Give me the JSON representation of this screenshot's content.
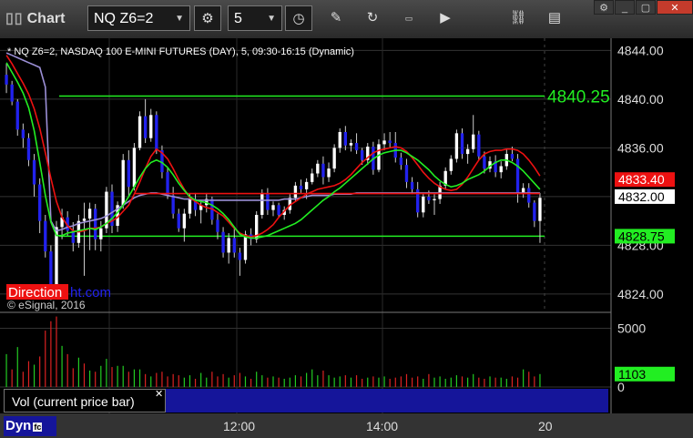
{
  "toolbar": {
    "app_title": "Chart",
    "symbol": "NQ Z6=2",
    "interval": "5",
    "icons": [
      "bars-icon",
      "chevron-down-icon",
      "gear-icon",
      "chevron-down-icon",
      "clock-icon",
      "pencil-icon",
      "refresh-icon",
      "get-icon",
      "play-icon",
      "link-icon",
      "comment-icon"
    ],
    "window_controls": [
      "settings-icon",
      "minimize-icon",
      "maximize-icon",
      "close-icon"
    ]
  },
  "chart_data": {
    "type": "candlestick",
    "title": "* NQ Z6=2, NASDAQ 100 E-MINI FUTURES (DAY), 5, 09:30-16:15 (Dynamic)",
    "watermark_left": "Direction",
    "watermark_right": "ht.com",
    "copyright": "© eSignal, 2016",
    "ylim": [
      4822.5,
      4845
    ],
    "yticks": [
      4824,
      4828,
      4832,
      4836,
      4840,
      4844
    ],
    "ytick_labels": [
      "4824.00",
      "4828.00",
      "4832.00",
      "4836.00",
      "4840.00",
      "4844.00"
    ],
    "xticks": [
      "12:00",
      "14:00",
      "20"
    ],
    "horizontal_lines": [
      {
        "value": 4840.25,
        "label": "4840.25",
        "color": "#22ee22"
      },
      {
        "value": 4828.75,
        "label": "4828.75",
        "color": "#22ee22"
      }
    ],
    "price_tags": [
      {
        "value": 4833.4,
        "label": "4833.40",
        "bg": "#ee1111",
        "fg": "#ffffff"
      },
      {
        "value": 4832.0,
        "label": "4832.00",
        "bg": "#ffffff",
        "fg": "#000000"
      },
      {
        "value": 4828.75,
        "label": "4828.75",
        "bg": "#22ee22",
        "fg": "#000000"
      }
    ],
    "candles": [
      [
        4842,
        4842.9,
        4840.5,
        4841.2
      ],
      [
        4841.2,
        4841.5,
        4839.5,
        4839.8
      ],
      [
        4839.8,
        4840,
        4837,
        4837.5
      ],
      [
        4837.5,
        4838,
        4836,
        4836.8
      ],
      [
        4836.8,
        4837.2,
        4834.5,
        4835
      ],
      [
        4835,
        4835.5,
        4832,
        4833
      ],
      [
        4833,
        4833.5,
        4829,
        4830
      ],
      [
        4830,
        4830.5,
        4827,
        4827.5
      ],
      [
        4827.5,
        4828,
        4823.5,
        4824.6
      ],
      [
        4824.6,
        4830,
        4824.3,
        4829.5
      ],
      [
        4829.5,
        4831,
        4828.5,
        4830.3
      ],
      [
        4830.3,
        4830.8,
        4828.8,
        4829.2
      ],
      [
        4829.2,
        4829.9,
        4827.5,
        4828.2
      ],
      [
        4828.2,
        4830.5,
        4827.8,
        4830
      ],
      [
        4830,
        4831.5,
        4825.5,
        4830.2
      ],
      [
        4830.2,
        4831.5,
        4827.6,
        4831
      ],
      [
        4831,
        4831.4,
        4827.6,
        4828.5
      ],
      [
        4828.5,
        4830,
        4827.5,
        4829.4
      ],
      [
        4829.4,
        4832.8,
        4829,
        4832.4
      ],
      [
        4832.4,
        4833,
        4829,
        4829.6
      ],
      [
        4829.6,
        4831.6,
        4829.1,
        4831.3
      ],
      [
        4831.3,
        4835.5,
        4831,
        4835
      ],
      [
        4835,
        4835.8,
        4832,
        4832.8
      ],
      [
        4832.8,
        4836.4,
        4832.5,
        4836
      ],
      [
        4836,
        4839,
        4835.8,
        4838.6
      ],
      [
        4838.6,
        4840,
        4836.4,
        4836.8
      ],
      [
        4836.8,
        4839.2,
        4836.5,
        4838.7
      ],
      [
        4838.7,
        4839,
        4835.5,
        4835.8
      ],
      [
        4835.8,
        4836.2,
        4833.5,
        4834
      ],
      [
        4834,
        4834.4,
        4831.8,
        4832.1
      ],
      [
        4832.1,
        4832.8,
        4830.2,
        4830.6
      ],
      [
        4830.6,
        4831,
        4829.1,
        4829.4
      ],
      [
        4829.4,
        4831,
        4828.3,
        4830.6
      ],
      [
        4830.6,
        4832.2,
        4830.2,
        4831.8
      ],
      [
        4831.8,
        4832.3,
        4830.4,
        4830.9
      ],
      [
        4830.9,
        4831.7,
        4829.8,
        4831.3
      ],
      [
        4831.3,
        4832.3,
        4830.7,
        4831.8
      ],
      [
        4831.8,
        4832,
        4829.7,
        4830.1
      ],
      [
        4830.1,
        4830.6,
        4828.5,
        4829.1
      ],
      [
        4829.1,
        4829.5,
        4827,
        4827.4
      ],
      [
        4827.4,
        4829,
        4826.5,
        4828.6
      ],
      [
        4828.6,
        4829.5,
        4827,
        4827.4
      ],
      [
        4827.4,
        4827.8,
        4825.5,
        4826.8
      ],
      [
        4826.8,
        4829.2,
        4826.5,
        4828.9
      ],
      [
        4828.9,
        4829.4,
        4828,
        4828.5
      ],
      [
        4828.5,
        4830.8,
        4828.2,
        4830.5
      ],
      [
        4830.5,
        4832.6,
        4830.2,
        4832.3
      ],
      [
        4832.3,
        4832.7,
        4830.5,
        4830.9
      ],
      [
        4830.9,
        4831.6,
        4830.4,
        4831.3
      ],
      [
        4831.3,
        4831.5,
        4830.3,
        4830.5
      ],
      [
        4830.5,
        4831.2,
        4830.1,
        4830.9
      ],
      [
        4830.9,
        4832.2,
        4830.6,
        4831.9
      ],
      [
        4831.9,
        4833.2,
        4831.6,
        4832.9
      ],
      [
        4832.9,
        4833.4,
        4832.3,
        4832.6
      ],
      [
        4832.6,
        4833.5,
        4831.8,
        4833.2
      ],
      [
        4833.2,
        4834.3,
        4833,
        4833.9
      ],
      [
        4833.9,
        4835,
        4833.6,
        4834.7
      ],
      [
        4834.7,
        4835.3,
        4833,
        4833.6
      ],
      [
        4833.6,
        4834.8,
        4833.2,
        4834.3
      ],
      [
        4834.3,
        4836.3,
        4834,
        4836
      ],
      [
        4836,
        4837.6,
        4835.6,
        4837.3
      ],
      [
        4837.3,
        4837.8,
        4835.8,
        4836.2
      ],
      [
        4836.2,
        4836.7,
        4835.7,
        4836.4
      ],
      [
        4836.4,
        4837.2,
        4835.5,
        4835.8
      ],
      [
        4835.8,
        4836,
        4834.6,
        4835
      ],
      [
        4835,
        4836.4,
        4834.6,
        4836.1
      ],
      [
        4836.1,
        4836.5,
        4833.8,
        4834.2
      ],
      [
        4834.2,
        4836.7,
        4834,
        4836.3
      ],
      [
        4836.3,
        4837.2,
        4835.8,
        4836.6
      ],
      [
        4836.6,
        4837.3,
        4836,
        4836.4
      ],
      [
        4836.4,
        4837.3,
        4834.8,
        4835.2
      ],
      [
        4835.2,
        4835.6,
        4834.2,
        4834.6
      ],
      [
        4834.6,
        4835.1,
        4832.7,
        4833.2
      ],
      [
        4833.2,
        4833.6,
        4832.2,
        4832.6
      ],
      [
        4832.6,
        4833.2,
        4830.3,
        4830.7
      ],
      [
        4830.7,
        4832.3,
        4830.3,
        4832
      ],
      [
        4832,
        4832.5,
        4831.4,
        4831.7
      ],
      [
        4831.7,
        4832.2,
        4830.5,
        4831.8
      ],
      [
        4831.8,
        4833.2,
        4831.4,
        4832.9
      ],
      [
        4832.9,
        4834.4,
        4832.6,
        4834.1
      ],
      [
        4834.1,
        4835.4,
        4833.8,
        4835.1
      ],
      [
        4835.1,
        4837.5,
        4834.8,
        4837.2
      ],
      [
        4837.2,
        4837.6,
        4835.1,
        4835.5
      ],
      [
        4835.5,
        4836.3,
        4834.7,
        4835.9
      ],
      [
        4835.9,
        4838.7,
        4835.6,
        4837.1
      ],
      [
        4837.1,
        4837.4,
        4835,
        4835.3
      ],
      [
        4835.3,
        4835.7,
        4833.9,
        4834.3
      ],
      [
        4834.3,
        4835.3,
        4834,
        4834.9
      ],
      [
        4834.9,
        4835.4,
        4833.6,
        4834
      ],
      [
        4834,
        4834.9,
        4833.5,
        4834.5
      ],
      [
        4834.5,
        4835.9,
        4834.2,
        4835.5
      ],
      [
        4835.5,
        4836.1,
        4834.9,
        4835.1
      ],
      [
        4835.1,
        4835.5,
        4831.5,
        4832.3
      ],
      [
        4832.3,
        4833.1,
        4831.9,
        4832.7
      ],
      [
        4832.7,
        4833.1,
        4831.1,
        4831.5
      ],
      [
        4831.5,
        4831.7,
        4829.5,
        4830
      ],
      [
        4830,
        4832.3,
        4828.2,
        4831.9
      ]
    ],
    "indicators": {
      "red_ma": [
        4843.6,
        4842.9,
        4842.1,
        4841.3,
        4840.4,
        4839.2,
        4837.6,
        4835.6,
        4833.5,
        4831.6,
        4830.3,
        4829.6,
        4829.2,
        4829.1,
        4829.2,
        4829.4,
        4829.4,
        4829.5,
        4829.8,
        4830,
        4830.3,
        4830.8,
        4831.3,
        4832.2,
        4833.2,
        4834.3,
        4835.3,
        4835.9,
        4835.6,
        4835.1,
        4834.3,
        4833.4,
        4832.6,
        4831.9,
        4831.6,
        4831.3,
        4831.1,
        4831,
        4830.7,
        4830.4,
        4829.9,
        4829.4,
        4829,
        4828.8,
        4828.7,
        4828.8,
        4829,
        4829.3,
        4829.7,
        4830.3,
        4830.8,
        4831.3,
        4831.6,
        4831.9,
        4832.2,
        4832.4,
        4832.6,
        4832.7,
        4832.8,
        4832.9,
        4833.1,
        4833.4,
        4833.8,
        4834.3,
        4834.8,
        4835.2,
        4835.6,
        4835.8,
        4835.9,
        4836,
        4836.1,
        4836,
        4835.7,
        4835.2,
        4834.6,
        4834,
        4833.5,
        4833.1,
        4832.8,
        4832.6,
        4832.5,
        4832.6,
        4833,
        4833.6,
        4834.3,
        4835,
        4835.5,
        4835.7,
        4835.8,
        4835.8,
        4835.9,
        4835.9,
        4835.8,
        4835.5,
        4835,
        4834.4,
        4833.7
      ],
      "green_ma": [
        4843,
        4842.2,
        4841.4,
        4840.5,
        4839.3,
        4837.4,
        4834.8,
        4832.1,
        4829.9,
        4828.8,
        4828.8,
        4829,
        4829.1,
        4829.2,
        4829.3,
        4829.4,
        4829.3,
        4829.5,
        4829.8,
        4830.2,
        4830.7,
        4831.3,
        4832,
        4832.8,
        4833.6,
        4834.3,
        4834.8,
        4835,
        4834.8,
        4834.4,
        4833.8,
        4833.1,
        4832.5,
        4832,
        4831.7,
        4831.6,
        4831.5,
        4831.3,
        4831,
        4830.6,
        4830.1,
        4829.5,
        4828.9,
        4828.7,
        4828.6,
        4828.6,
        4828.7,
        4828.8,
        4829,
        4829.2,
        4829.4,
        4829.6,
        4829.8,
        4830.1,
        4830.5,
        4830.9,
        4831.3,
        4831.7,
        4832,
        4832.4,
        4832.7,
        4833.1,
        4833.5,
        4833.9,
        4834.3,
        4834.7,
        4835.1,
        4835.4,
        4835.6,
        4835.7,
        4835.8,
        4835.8,
        4835.6,
        4835.3,
        4835,
        4834.6,
        4834.2,
        4833.7,
        4833.3,
        4833,
        4832.8,
        4832.9,
        4833.1,
        4833.4,
        4833.6,
        4833.8,
        4834.1,
        4834.5,
        4834.8,
        4835,
        4835,
        4834.8,
        4834.5,
        4834.1,
        4833.6,
        4833.1,
        4832.6
      ],
      "purple_ma": [
        4843.8,
        4843.6,
        4843.4,
        4843.2,
        4843,
        4842.8,
        4842.6,
        4841,
        4830,
        4829.2,
        4829.3,
        4829.5,
        4829.6,
        4829.8,
        4829.9,
        4830,
        4830.1,
        4830.2,
        4830.4,
        4830.7,
        4831,
        4831.3,
        4831.6,
        4831.9,
        4832.1,
        4832.2,
        4832.3,
        4832.3,
        4832.2,
        4832.1,
        4832,
        4831.9,
        4831.8,
        4831.8,
        4831.7,
        4831.7,
        4831.7,
        4831.7,
        4831.7,
        4831.7,
        4831.7,
        4831.7,
        4831.7,
        4831.7,
        4831.7,
        4831.7,
        4831.7,
        4831.7,
        4831.7,
        4831.7,
        4831.8,
        4831.8,
        4831.8,
        4831.9,
        4832,
        4832.1,
        4832.1,
        4832.1,
        4832.1,
        4832.2,
        4832.2,
        4832.2,
        4832.2,
        4832.3,
        4832.3,
        4832.3,
        4832.3,
        4832.3,
        4832.3,
        4832.3,
        4832.3,
        4832.3,
        4832.3,
        4832.3,
        4832.3,
        4832.3,
        4832.3,
        4832.3,
        4832.3,
        4832.3,
        4832.3,
        4832.3,
        4832.3,
        4832.3,
        4832.3,
        4832.3,
        4832.3,
        4832.3,
        4832.3,
        4832.3,
        4832.3,
        4832.3,
        4832.3,
        4832.3,
        4832.3,
        4832.3,
        4832.3
      ],
      "red_flat": {
        "start_index": 23,
        "value": 4832.25
      }
    },
    "volume": {
      "ylim": [
        0,
        6200
      ],
      "yticks": [
        0,
        5000
      ],
      "ytick_labels": [
        "0",
        "5000"
      ],
      "current_tag": "1103",
      "label": "Vol (current price bar)",
      "values": [
        2800,
        1500,
        3400,
        1300,
        2200,
        1900,
        2600,
        4800,
        5600,
        6000,
        3500,
        2800,
        1600,
        2500,
        2000,
        1400,
        1300,
        1800,
        2400,
        1700,
        1800,
        1800,
        1300,
        1500,
        1500,
        1100,
        900,
        1200,
        1300,
        900,
        1100,
        1000,
        800,
        1000,
        700,
        1200,
        800,
        1300,
        900,
        1100,
        800,
        1000,
        1200,
        900,
        700,
        1300,
        1000,
        800,
        900,
        800,
        700,
        800,
        1000,
        900,
        1200,
        1500,
        1000,
        1400,
        1000,
        800,
        900,
        1000,
        800,
        1000,
        700,
        800,
        900,
        800,
        900,
        700,
        800,
        900,
        1100,
        800,
        900,
        700,
        1100,
        800,
        900,
        700,
        800,
        1000,
        900,
        800,
        1100,
        800,
        700,
        900,
        800,
        800,
        700,
        900,
        800,
        1500,
        1300,
        900,
        1103
      ],
      "colors": [
        "g",
        "r",
        "g",
        "r",
        "r",
        "g",
        "r",
        "r",
        "r",
        "r",
        "g",
        "r",
        "r",
        "g",
        "r",
        "g",
        "r",
        "g",
        "g",
        "r",
        "g",
        "g",
        "r",
        "g",
        "g",
        "r",
        "g",
        "r",
        "r",
        "r",
        "r",
        "r",
        "g",
        "g",
        "r",
        "g",
        "g",
        "r",
        "r",
        "r",
        "g",
        "r",
        "r",
        "g",
        "r",
        "g",
        "g",
        "r",
        "g",
        "r",
        "g",
        "g",
        "g",
        "r",
        "g",
        "g",
        "g",
        "r",
        "g",
        "g",
        "g",
        "r",
        "g",
        "r",
        "r",
        "g",
        "r",
        "g",
        "g",
        "r",
        "r",
        "r",
        "r",
        "r",
        "r",
        "g",
        "r",
        "g",
        "g",
        "g",
        "g",
        "g",
        "r",
        "g",
        "g",
        "r",
        "r",
        "g",
        "r",
        "g",
        "g",
        "r",
        "r",
        "g",
        "r",
        "r",
        "g"
      ]
    }
  }
}
